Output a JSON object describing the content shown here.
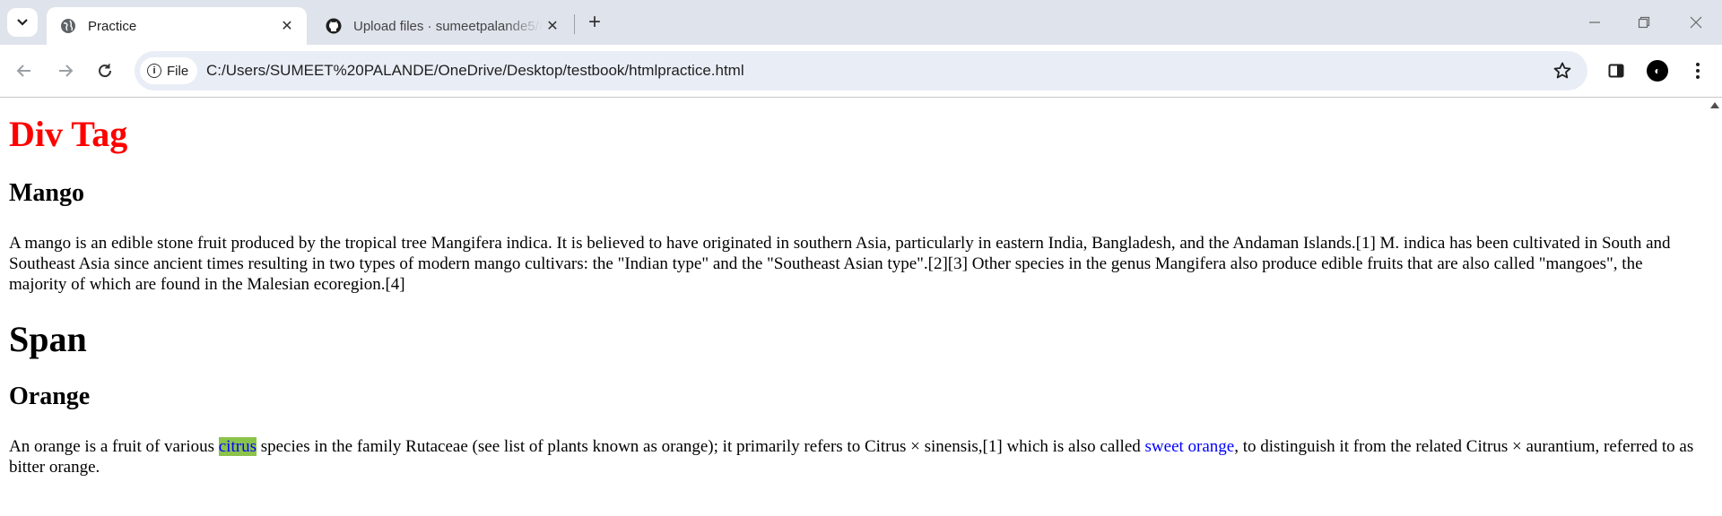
{
  "browser": {
    "tabs": [
      {
        "title": "Practice",
        "close": "✕"
      },
      {
        "title": "Upload files · sumeetpalande5/H",
        "close": "✕"
      }
    ],
    "new_tab": "+",
    "address": {
      "chip_label": "File",
      "url": "C:/Users/SUMEET%20PALANDE/OneDrive/Desktop/testbook/htmlpractice.html"
    },
    "icons": [
      "tab-search-icon",
      "globe-icon",
      "github-icon",
      "back-icon",
      "forward-icon",
      "reload-icon",
      "info-icon",
      "star-icon",
      "side-panel-icon",
      "profile-icon",
      "menu-icon",
      "minimize-icon",
      "restore-icon",
      "close-window-icon"
    ],
    "colors": {
      "tabstrip": "#dfe3eb",
      "omnibox": "#e9edf6"
    }
  },
  "page": {
    "div_heading": "Div Tag",
    "mango_heading": "Mango",
    "mango_text": "A mango is an edible stone fruit produced by the tropical tree Mangifera indica. It is believed to have originated in southern Asia, particularly in eastern India, Bangladesh, and the Andaman Islands.[1] M. indica has been cultivated in South and Southeast Asia since ancient times resulting in two types of modern mango cultivars: the \"Indian type\" and the \"Southeast Asian type\".[2][3] Other species in the genus Mangifera also produce edible fruits that are also called \"mangoes\", the majority of which are found in the Malesian ecoregion.[4]",
    "span_heading": "Span",
    "orange_heading": "Orange",
    "orange_text_1": "An orange is a fruit of various ",
    "orange_highlight": "citrus",
    "orange_text_2": " species in the family Rutaceae (see list of plants known as orange); it primarily refers to Citrus × sinensis,[1] which is also called ",
    "orange_blue": "sweet orange",
    "orange_text_3": ", to distinguish it from the related Citrus × aurantium, referred to as bitter orange.",
    "colors": {
      "div_heading": "#ff0000",
      "highlight_bg": "#8bc34a",
      "link_text": "#0000ff"
    }
  }
}
